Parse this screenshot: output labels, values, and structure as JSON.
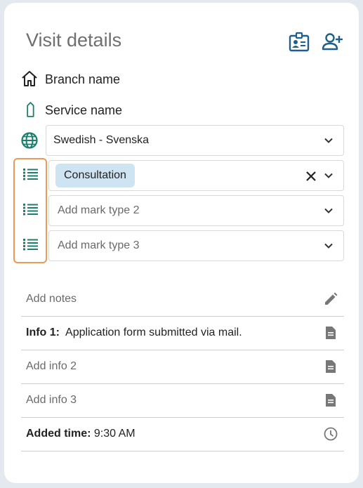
{
  "header": {
    "title": "Visit details",
    "icons": [
      "id-card-icon",
      "add-person-icon"
    ]
  },
  "branch": {
    "label": "Branch name",
    "icon": "home-icon"
  },
  "service": {
    "label": "Service name",
    "icon": "tag-icon"
  },
  "language": {
    "value": "Swedish - Svenska",
    "icon": "globe-icon"
  },
  "marks": [
    {
      "chip": "Consultation",
      "icon": "list-icon"
    },
    {
      "placeholder": "Add mark type 2",
      "icon": "list-icon"
    },
    {
      "placeholder": "Add mark type 3",
      "icon": "list-icon"
    }
  ],
  "notes": {
    "placeholder": "Add notes",
    "icon": "pencil-icon"
  },
  "info": [
    {
      "label": "Info 1:",
      "value": "Application form submitted via mail.",
      "icon": "document-icon"
    },
    {
      "placeholder": "Add info 2",
      "icon": "document-icon"
    },
    {
      "placeholder": "Add info 3",
      "icon": "document-icon"
    }
  ],
  "added_time": {
    "label": "Added time:",
    "value": "9:30 AM",
    "icon": "clock-icon"
  },
  "colors": {
    "accent": "#1a7f6e",
    "header_icon": "#1f5f8b",
    "highlight": "#ed9a57",
    "chip": "#cfe4f2"
  }
}
